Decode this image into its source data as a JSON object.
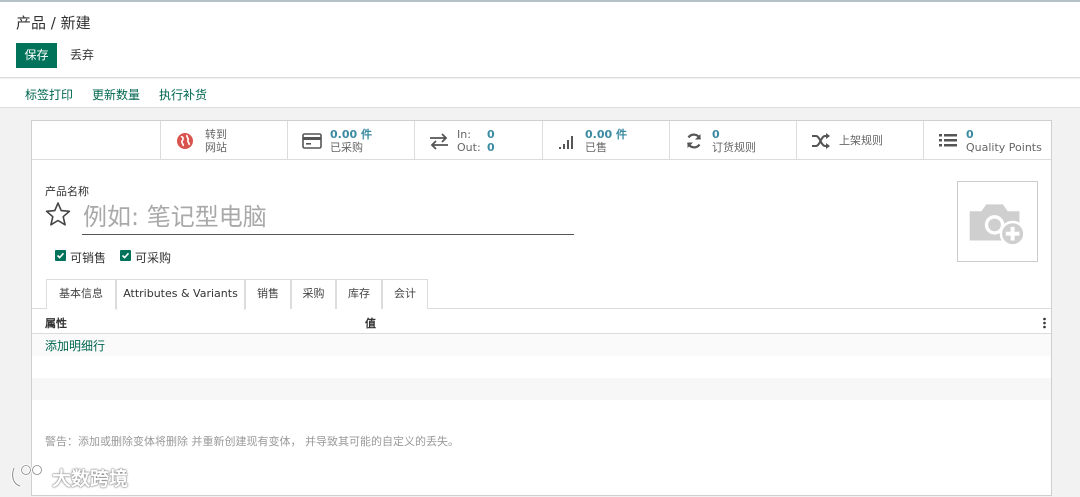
{
  "control_panel": {
    "breadcrumb": "产品 / 新建",
    "save_label": "保存",
    "discard_label": "丢弃"
  },
  "status_actions": [
    "标签打印",
    "更新数量",
    "执行补货"
  ],
  "smart_buttons": {
    "website": {
      "line1": "转到",
      "line2": "网站",
      "icon": "globe-icon"
    },
    "purchased": {
      "value": "0.00 件",
      "label": "已采购",
      "icon": "credit-card-icon"
    },
    "in_out": {
      "in_label": "In:",
      "in_value": "0",
      "out_label": "Out:",
      "out_value": "0",
      "icon": "exchange-icon"
    },
    "sold": {
      "value": "0.00 件",
      "label": "已售",
      "icon": "signal-bars-icon"
    },
    "reorder": {
      "value": "0",
      "label": "订货规则",
      "icon": "refresh-icon"
    },
    "putaway": {
      "label": "上架规则",
      "icon": "random-icon"
    },
    "quality": {
      "value": "0",
      "label": "Quality Points",
      "icon": "list-icon"
    }
  },
  "form": {
    "name_label": "产品名称",
    "name_placeholder": "例如: 笔记型电脑",
    "can_be_sold": "可销售",
    "can_be_purchased": "可采购"
  },
  "tabs": [
    "基本信息",
    "Attributes & Variants",
    "销售",
    "采购",
    "库存",
    "会计"
  ],
  "active_tab": "Attributes & Variants",
  "table": {
    "columns": [
      "属性",
      "值"
    ],
    "add_line": "添加明细行"
  },
  "warning": "警告：添加或删除变体将删除 并重新创建现有变体， 并导致其可能的自定义的丢失。",
  "watermark": "大数跨境",
  "colors": {
    "brand": "#00735a",
    "link": "#00664f",
    "stat": "#3a8ba1"
  }
}
